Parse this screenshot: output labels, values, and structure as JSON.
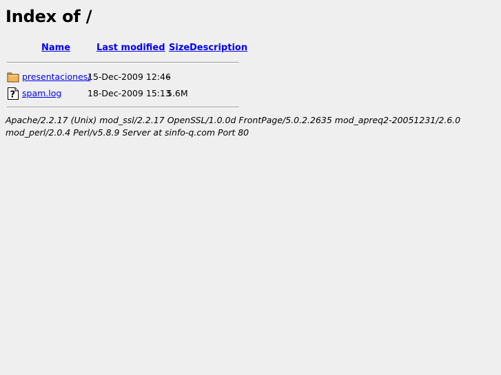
{
  "heading": "Index of /",
  "columns": {
    "name": "Name",
    "last_modified": "Last modified",
    "size": "Size",
    "description": "Description"
  },
  "rows": [
    {
      "icon": "folder-icon",
      "name": "presentaciones/",
      "last_modified": "15-Dec-2009 12:46",
      "size": "-",
      "description": ""
    },
    {
      "icon": "unknown-file-icon",
      "name": "spam.log",
      "last_modified": "18-Dec-2009 15:13",
      "size": "5.6M",
      "description": ""
    }
  ],
  "server_signature": "Apache/2.2.17 (Unix) mod_ssl/2.2.17 OpenSSL/1.0.0d FrontPage/5.0.2.2635 mod_apreq2-20051231/2.6.0 mod_perl/2.0.4 Perl/v5.8.9 Server at sinfo-q.com Port 80"
}
